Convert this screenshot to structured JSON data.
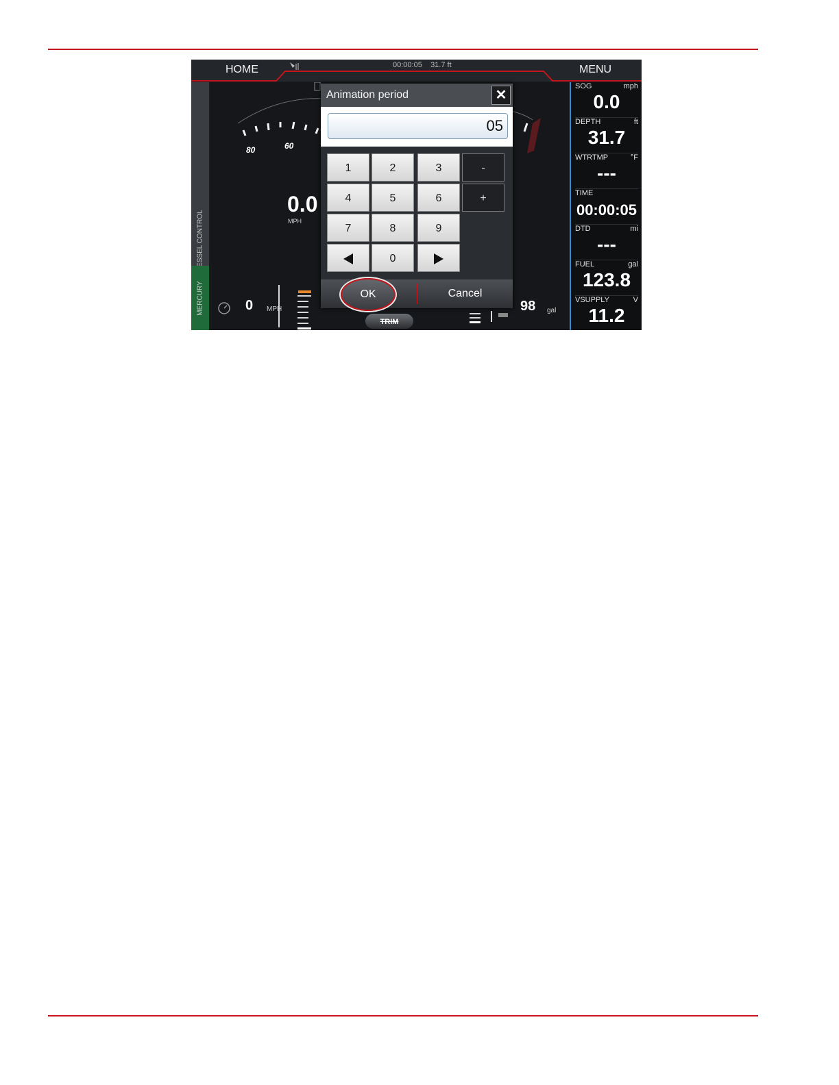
{
  "topbar": {
    "home_label": "HOME",
    "menu_label": "MENU",
    "status_time": "00:00:05",
    "status_depth": "31.7 ft"
  },
  "left_rail": {
    "vessel_control_label": "VESSEL CONTROL",
    "mercury_label": "MERCURY"
  },
  "gauge": {
    "tick_labels": [
      "80",
      "60"
    ],
    "speed_value": "0.0",
    "speed_unit": "MPH",
    "bottom_speed_value": "0",
    "bottom_speed_unit": "MPH",
    "trim_label": "TRIM",
    "fuel_value": "98",
    "fuel_unit": "gal"
  },
  "dialog": {
    "title": "Animation period",
    "value": "05",
    "keys": [
      "1",
      "2",
      "3",
      "-",
      "4",
      "5",
      "6",
      "+",
      "7",
      "8",
      "9",
      "0"
    ],
    "ok_label": "OK",
    "cancel_label": "Cancel"
  },
  "data_panel": [
    {
      "label": "SOG",
      "unit": "mph",
      "value": "0.0"
    },
    {
      "label": "DEPTH",
      "unit": "ft",
      "value": "31.7"
    },
    {
      "label": "WTRTMP",
      "unit": "°F",
      "value": "---"
    },
    {
      "label": "TIME",
      "unit": "",
      "value": "00:00:05"
    },
    {
      "label": "DTD",
      "unit": "mi",
      "value": "---"
    },
    {
      "label": "FUEL",
      "unit": "gal",
      "value": "123.8"
    },
    {
      "label": "VSUPPLY",
      "unit": "V",
      "value": "11.2"
    }
  ],
  "colors": {
    "accent_red": "#c4161c",
    "panel_blue": "#2f8fd2",
    "mercury_green": "#1f6b3a",
    "trim_orange": "#e8862a"
  }
}
